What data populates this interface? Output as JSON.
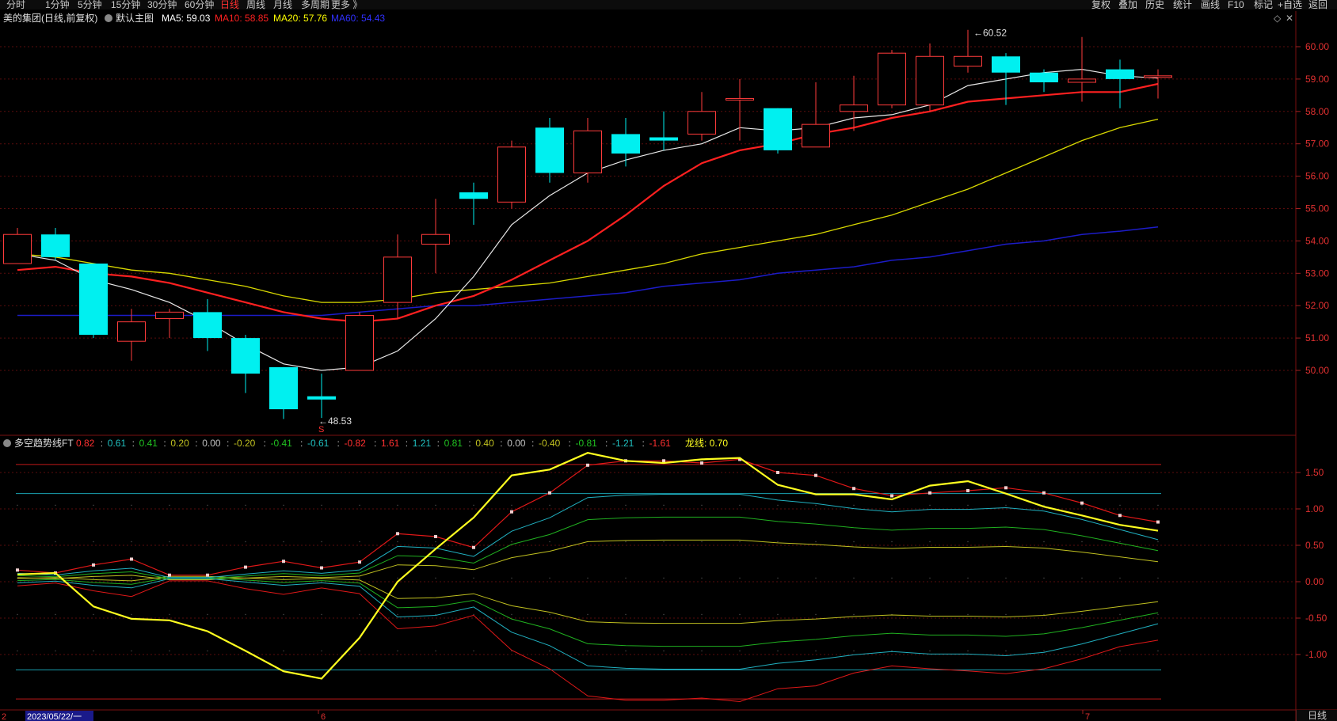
{
  "toolbar": {
    "periods": [
      "分时",
      "1分钟",
      "5分钟",
      "15分钟",
      "30分钟",
      "60分钟",
      "日线",
      "周线",
      "月线",
      "多周期",
      "更多 》"
    ],
    "active_period": "日线",
    "right_buttons": [
      "复权",
      "叠加",
      "历史",
      "统计",
      "画线",
      "F10",
      "标记",
      "+自选",
      "返回"
    ]
  },
  "main_panel": {
    "stock": "美的集团(日线,前复权)",
    "template": "默认主图",
    "ma": [
      {
        "label": "MA5: 59.03",
        "color": "#ffffff"
      },
      {
        "label": "MA10: 58.85",
        "color": "#ff2020"
      },
      {
        "label": "MA20: 57.76",
        "color": "#ffff00"
      },
      {
        "label": "MA60: 54.43",
        "color": "#3030ff"
      }
    ],
    "y_ticks": [
      "60.00",
      "59.00",
      "58.00",
      "57.00",
      "56.00",
      "55.00",
      "54.00",
      "53.00",
      "52.00",
      "51.00",
      "50.00"
    ],
    "high_label": "60.52",
    "low_label": "48.53",
    "s_mark": "S"
  },
  "indicator_panel": {
    "name": "多空趋势线FT",
    "params": [
      {
        "v": "0.82",
        "c": "#ff3030"
      },
      {
        "v": "0.61",
        "c": "#20c0c0"
      },
      {
        "v": "0.41",
        "c": "#20c020"
      },
      {
        "v": "0.20",
        "c": "#c0c020"
      },
      {
        "v": "0.00",
        "c": "#c0c0c0"
      },
      {
        "v": "-0.20",
        "c": "#c0c020"
      },
      {
        "v": "-0.41",
        "c": "#20c020"
      },
      {
        "v": "-0.61",
        "c": "#20c0c0"
      },
      {
        "v": "-0.82",
        "c": "#ff3030"
      },
      {
        "v": "1.61",
        "c": "#ff3030"
      },
      {
        "v": "1.21",
        "c": "#20c0c0"
      },
      {
        "v": "0.81",
        "c": "#20c020"
      },
      {
        "v": "0.40",
        "c": "#c0c020"
      },
      {
        "v": "0.00",
        "c": "#c0c0c0"
      },
      {
        "v": "-0.40",
        "c": "#c0c020"
      },
      {
        "v": "-0.81",
        "c": "#20c020"
      },
      {
        "v": "-1.21",
        "c": "#20c0c0"
      },
      {
        "v": "-1.61",
        "c": "#ff3030"
      }
    ],
    "dragon_label": "龙线: 0.70",
    "y_ticks": [
      "1.50",
      "1.00",
      "0.50",
      "0.00",
      "-0.50",
      "-1.00"
    ]
  },
  "x_axis": {
    "date_box": "2023/05/22/一",
    "first_char": "2",
    "month_labels": [
      "6",
      "7"
    ]
  },
  "bottom_right": "日线",
  "chart_data": {
    "type": "candlestick",
    "ohlc": [
      [
        53.3,
        54.2,
        53.3,
        54.4
      ],
      [
        54.2,
        53.5,
        53.4,
        54.4
      ],
      [
        53.3,
        51.1,
        51.0,
        53.3
      ],
      [
        50.9,
        51.5,
        50.3,
        51.9
      ],
      [
        51.6,
        51.8,
        51.0,
        51.9
      ],
      [
        51.8,
        51.0,
        50.6,
        52.2
      ],
      [
        51.0,
        49.9,
        49.3,
        51.1
      ],
      [
        50.1,
        48.8,
        48.5,
        50.1
      ],
      [
        49.2,
        49.1,
        48.53,
        49.9
      ],
      [
        50.0,
        51.7,
        50.0,
        51.8
      ],
      [
        52.1,
        53.5,
        51.6,
        54.2
      ],
      [
        53.9,
        54.2,
        53.0,
        55.3
      ],
      [
        55.5,
        55.3,
        54.5,
        55.8
      ],
      [
        55.2,
        56.9,
        55.0,
        57.1
      ],
      [
        57.5,
        56.1,
        55.8,
        57.8
      ],
      [
        56.1,
        57.4,
        55.8,
        57.8
      ],
      [
        57.3,
        56.7,
        56.3,
        57.8
      ],
      [
        57.2,
        57.1,
        56.8,
        58.0
      ],
      [
        57.3,
        58.0,
        57.1,
        58.6
      ],
      [
        58.4,
        58.4,
        57.1,
        59.0
      ],
      [
        58.1,
        56.8,
        56.7,
        58.1
      ],
      [
        56.9,
        57.6,
        56.9,
        58.9
      ],
      [
        58.0,
        58.2,
        57.4,
        59.1
      ],
      [
        58.2,
        59.8,
        58.1,
        59.9
      ],
      [
        58.2,
        59.7,
        58.0,
        60.1
      ],
      [
        59.4,
        59.7,
        59.2,
        60.52
      ],
      [
        59.7,
        59.2,
        58.2,
        59.8
      ],
      [
        59.2,
        58.9,
        58.6,
        59.3
      ],
      [
        58.9,
        59.0,
        58.3,
        60.3
      ],
      [
        59.3,
        59.0,
        58.1,
        59.6
      ],
      [
        59.1,
        59.1,
        58.4,
        59.3
      ]
    ],
    "ma5": [
      53.6,
      53.4,
      52.8,
      52.5,
      52.1,
      51.5,
      50.8,
      50.2,
      50.0,
      50.1,
      50.6,
      51.6,
      52.9,
      54.5,
      55.4,
      56.1,
      56.5,
      56.8,
      57.0,
      57.5,
      57.4,
      57.5,
      57.8,
      57.9,
      58.2,
      58.8,
      59.0,
      59.2,
      59.3,
      59.1,
      59.03
    ],
    "ma10": [
      53.1,
      53.2,
      53.0,
      52.9,
      52.7,
      52.4,
      52.1,
      51.8,
      51.6,
      51.5,
      51.6,
      52.0,
      52.3,
      52.8,
      53.4,
      54.0,
      54.8,
      55.7,
      56.4,
      56.8,
      57.0,
      57.3,
      57.5,
      57.8,
      58.0,
      58.3,
      58.4,
      58.5,
      58.6,
      58.6,
      58.85
    ],
    "ma20": [
      53.6,
      53.5,
      53.3,
      53.1,
      53.0,
      52.8,
      52.6,
      52.3,
      52.1,
      52.1,
      52.2,
      52.4,
      52.5,
      52.6,
      52.7,
      52.9,
      53.1,
      53.3,
      53.6,
      53.8,
      54.0,
      54.2,
      54.5,
      54.8,
      55.2,
      55.6,
      56.1,
      56.6,
      57.1,
      57.5,
      57.76
    ],
    "ma60": [
      51.7,
      51.7,
      51.7,
      51.7,
      51.7,
      51.7,
      51.7,
      51.7,
      51.7,
      51.8,
      51.9,
      52.0,
      52.0,
      52.1,
      52.2,
      52.3,
      52.4,
      52.6,
      52.7,
      52.8,
      53.0,
      53.1,
      53.2,
      53.4,
      53.5,
      53.7,
      53.9,
      54.0,
      54.2,
      54.3,
      54.43
    ],
    "ind_red": [
      0.16,
      0.12,
      0.23,
      0.31,
      0.09,
      0.09,
      0.2,
      0.28,
      0.19,
      0.27,
      0.66,
      0.62,
      0.47,
      0.96,
      1.22,
      1.6,
      1.66,
      1.66,
      1.63,
      1.68,
      1.5,
      1.46,
      1.28,
      1.18,
      1.22,
      1.25,
      1.29,
      1.22,
      1.08,
      0.91,
      0.82
    ],
    "dragon": [
      0.1,
      0.12,
      -0.34,
      -0.51,
      -0.53,
      -0.68,
      -0.95,
      -1.23,
      -1.33,
      -0.77,
      0.0,
      0.45,
      0.88,
      1.46,
      1.54,
      1.77,
      1.66,
      1.63,
      1.68,
      1.7,
      1.33,
      1.2,
      1.2,
      1.13,
      1.32,
      1.38,
      1.21,
      1.03,
      0.91,
      0.78,
      0.7
    ],
    "envelope_levels": {
      "red": 1.61,
      "cyan": 1.21,
      "green": 0.81,
      "yellow": 0.4
    },
    "envelope_shape": [
      0.1,
      0.08,
      0.13,
      0.16,
      0.05,
      0.05,
      0.09,
      0.13,
      0.1,
      0.14,
      0.42,
      0.4,
      0.3,
      0.6,
      0.76,
      1.0,
      1.03,
      1.04,
      1.04,
      1.04,
      0.97,
      0.93,
      0.87,
      0.83,
      0.86,
      0.86,
      0.88,
      0.84,
      0.74,
      0.62,
      0.5
    ]
  }
}
